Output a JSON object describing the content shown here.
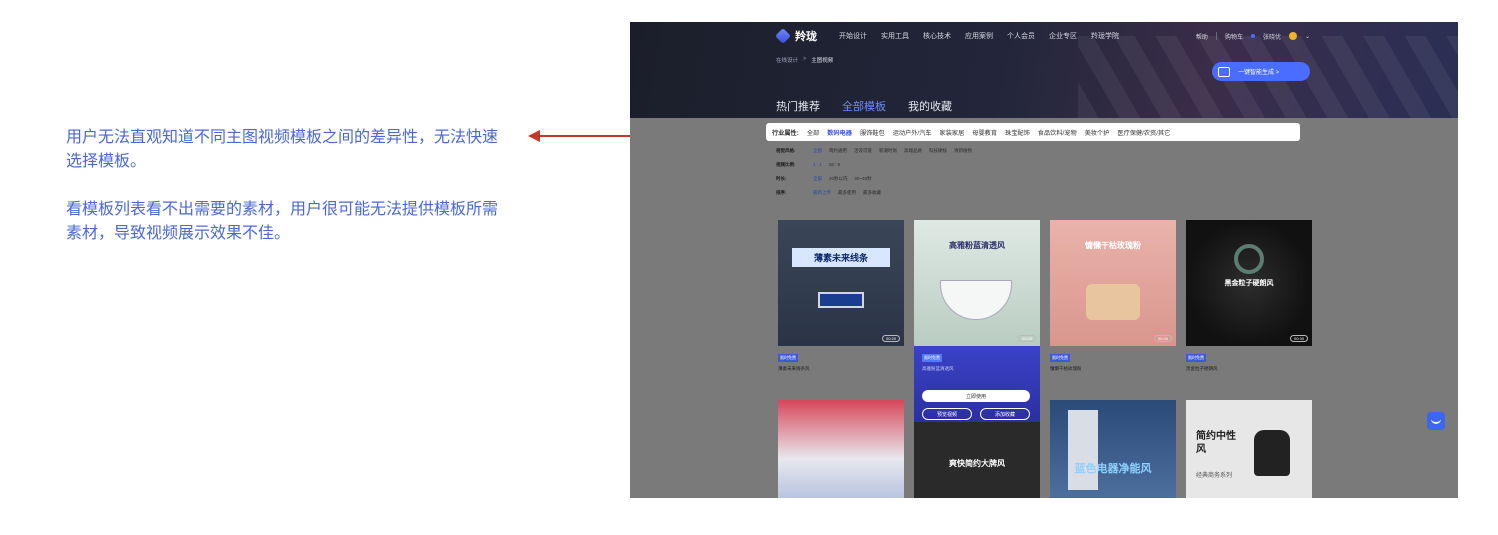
{
  "annotation": {
    "line1": "用户无法直观知道不同主图视频模板之间的差异性，无法快速选择模板。",
    "line2": "看模板列表看不出需要的素材，用户很可能无法提供模板所需素材，导致视频展示效果不佳。"
  },
  "header": {
    "logo": "羚珑",
    "nav": [
      "开始设计",
      "实用工具",
      "核心技术",
      "应用案例",
      "个人会员",
      "企业专区",
      "羚珑学院"
    ],
    "help": "帮助",
    "cart": "购物车",
    "user": "张晓优"
  },
  "breadcrumb": {
    "root": "在线设计",
    "sep": ">",
    "current": "主图视频"
  },
  "generate_button": "一键智能生成 >",
  "tabs": [
    "热门推荐",
    "全部模板",
    "我的收藏"
  ],
  "filters": {
    "industry": {
      "label": "行业属性:",
      "options": [
        "全部",
        "数码电器",
        "服饰鞋包",
        "运动户外/汽车",
        "家装家居",
        "母婴教育",
        "珠宝配饰",
        "食品饮料/宠物",
        "美妆个护",
        "医疗保健/农资/其它"
      ],
      "selected": "数码电器"
    },
    "style": {
      "label": "视觉风格:",
      "options": [
        "全部",
        "简约通用",
        "活泼可爱",
        "新潮时尚",
        "高端品质",
        "科技硬核",
        "清新植物"
      ]
    },
    "ratio": {
      "label": "视频比例:",
      "options": [
        "1 : 1",
        "16 : 9"
      ]
    },
    "duration": {
      "label": "时长:",
      "options": [
        "全部",
        "20秒以内",
        "20~40秒"
      ]
    },
    "sort": {
      "label": "排序:",
      "options": [
        "最新上传",
        "最多使用",
        "最多收藏"
      ]
    }
  },
  "cards": [
    {
      "title": "薄素未来线条",
      "badge": "限时免费",
      "name": "薄素未来线条风",
      "duration": "00:20"
    },
    {
      "title": "高雅粉蓝清透风",
      "badge": "限时免费",
      "name": "高雅粉蓝清透风",
      "duration": "00:20"
    },
    {
      "title": "慵懒干枯玫瑰粉",
      "badge": "限时免费",
      "name": "慵懒干枯玫瑰粉",
      "duration": "00:30"
    },
    {
      "title": "黑金粒子硬朗风",
      "badge": "限时免费",
      "name": "黑金粒子硬朗风",
      "duration": "00:30"
    }
  ],
  "card_actions": {
    "use": "立即使用",
    "preview": "预览视频",
    "favorite": "添加收藏"
  },
  "second_row": [
    "爽快简约大牌风",
    "蓝色电器净能风",
    "简约中性风",
    "经典商务系列"
  ]
}
